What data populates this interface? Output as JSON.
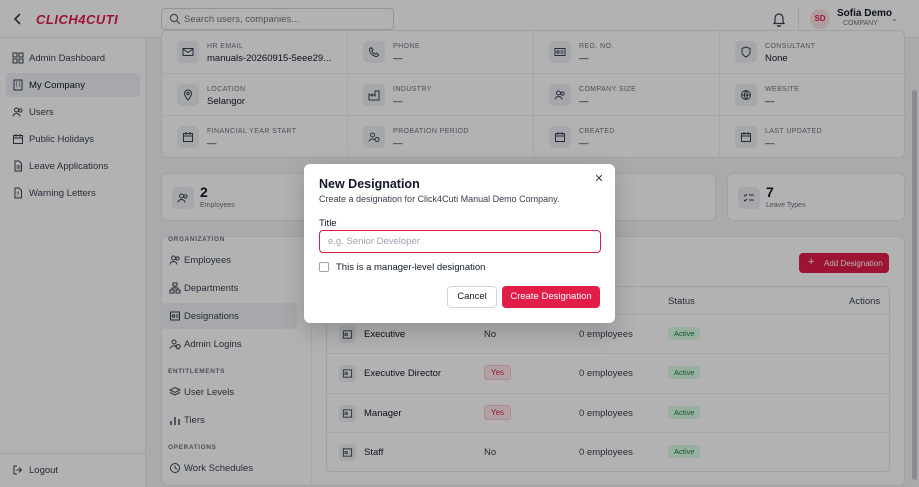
{
  "brand": {
    "logo_text": "CLICH4CUTI",
    "accent": "#e11d48"
  },
  "topbar": {
    "search_placeholder": "Search users, companies...",
    "user_initials": "SD",
    "user_name": "Sofia Demo",
    "user_role": "COMPANY"
  },
  "sidebar": {
    "items": [
      {
        "label": "Admin Dashboard",
        "icon": "grid-icon"
      },
      {
        "label": "My Company",
        "icon": "building-icon",
        "active": true
      },
      {
        "label": "Users",
        "icon": "users-icon"
      },
      {
        "label": "Public Holidays",
        "icon": "calendar-icon"
      },
      {
        "label": "Leave Applications",
        "icon": "document-icon"
      },
      {
        "label": "Warning Letters",
        "icon": "warning-document-icon"
      }
    ],
    "logout": "Logout"
  },
  "company_info": [
    {
      "label": "HR EMAIL",
      "value": "manuals-20260915-5eee29..."
    },
    {
      "label": "PHONE",
      "value": "—"
    },
    {
      "label": "REG. NO.",
      "value": "—"
    },
    {
      "label": "CONSULTANT",
      "value": "None"
    },
    {
      "label": "LOCATION",
      "value": "Selangor"
    },
    {
      "label": "INDUSTRY",
      "value": "—"
    },
    {
      "label": "COMPANY SIZE",
      "value": "—"
    },
    {
      "label": "WEBSITE",
      "value": "—"
    },
    {
      "label": "FINANCIAL YEAR START",
      "value": "—"
    },
    {
      "label": "PROBATION PERIOD",
      "value": "—"
    },
    {
      "label": "CREATED",
      "value": "—"
    },
    {
      "label": "LAST UPDATED",
      "value": "—"
    }
  ],
  "stats": {
    "employees": {
      "value": "2",
      "label": "Employees"
    },
    "partial_label": "s",
    "leave_types": {
      "value": "7",
      "label": "Leave Types"
    }
  },
  "org_nav": {
    "organization_label": "ORGANIZATION",
    "employees": "Employees",
    "departments": "Departments",
    "designations": "Designations",
    "admin_logins": "Admin Logins",
    "entitlements_label": "ENTITLEMENTS",
    "user_levels": "User Levels",
    "tiers": "Tiers",
    "operations_label": "OPERATIONS",
    "work_schedules": "Work Schedules"
  },
  "designations": {
    "add_button": "Add Designation",
    "columns": {
      "employees": "es",
      "status": "Status",
      "actions": "Actions"
    },
    "rows": [
      {
        "name": "Executive",
        "manager": "No",
        "employees": "0 employees",
        "status": "Active"
      },
      {
        "name": "Executive Director",
        "manager": "Yes",
        "employees": "0 employees",
        "status": "Active"
      },
      {
        "name": "Manager",
        "manager": "Yes",
        "employees": "0 employees",
        "status": "Active"
      },
      {
        "name": "Staff",
        "manager": "No",
        "employees": "0 employees",
        "status": "Active"
      }
    ]
  },
  "modal": {
    "title": "New Designation",
    "subtitle": "Create a designation for Click4Cuti Manual Demo Company.",
    "title_label": "Title",
    "title_placeholder": "e.g. Senior Developer",
    "checkbox_label": "This is a manager-level designation",
    "cancel": "Cancel",
    "create": "Create Designation"
  }
}
